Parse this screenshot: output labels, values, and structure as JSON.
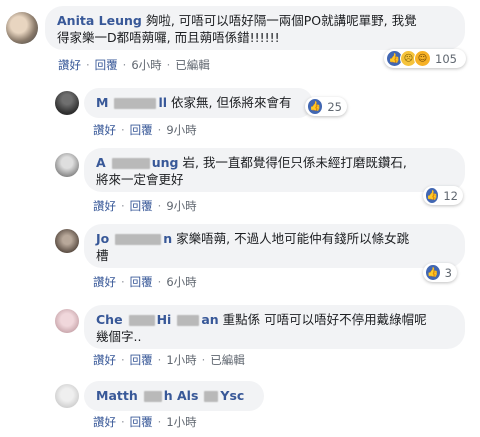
{
  "comments": [
    {
      "author": "Anita Leung",
      "text_line1": "夠啦, 可唔可以唔好隔一兩個PO就講呢單野, 我覺",
      "text_line2": "得家樂一D都唔蒴囉, 而且蒴唔係錯!!!!!!",
      "actions": {
        "like": "讚好",
        "reply": "回覆",
        "time": "6小時",
        "edited": "已編輯"
      },
      "reaction_count": "105"
    },
    {
      "author": "M",
      "author_tail": "ll",
      "text_line1": "依家無, 但係將來會有",
      "actions": {
        "like": "讚好",
        "reply": "回覆",
        "time": "9小時"
      },
      "reaction_count": "25"
    },
    {
      "author": "A",
      "author_tail": "ung",
      "text_line1": "岩, 我一直都覺得佢只係未經打磨既鑽石,",
      "text_line2": "將來一定會更好",
      "actions": {
        "like": "讚好",
        "reply": "回覆",
        "time": "9小時"
      },
      "reaction_count": "12"
    },
    {
      "author": "Jo",
      "author_tail": "n",
      "text_line1": "家樂唔蒴, 不過人地可能仲有錢所以條女跳",
      "text_line2": "槽",
      "actions": {
        "like": "讚好",
        "reply": "回覆",
        "time": "6小時"
      },
      "reaction_count": "3"
    },
    {
      "author": "Che",
      "author_mid": "Hi",
      "author_tail": "an",
      "text_line1": "重點係 可唔可以唔好不停用戴綠帽呢",
      "text_line2": "幾個字..",
      "actions": {
        "like": "讚好",
        "reply": "回覆",
        "time": "1小時",
        "edited": "已編輯"
      }
    },
    {
      "author": "Matth",
      "author_mid": "h Als",
      "author_tail": "Ysc",
      "actions": {
        "like": "讚好",
        "reply": "回覆",
        "time": "1小時"
      }
    }
  ],
  "colors": {
    "link": "#385898",
    "bubble": "#f2f3f5",
    "meta": "#606770",
    "like": "#4267b2"
  }
}
